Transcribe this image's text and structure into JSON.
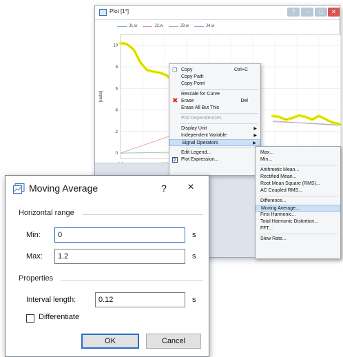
{
  "plot_window": {
    "title": "Plot [1*]",
    "legend": [
      {
        "label": "J1.w",
        "color": "#8da9c9"
      },
      {
        "label": "J2.w",
        "color": "#e88ea0"
      },
      {
        "label": "J3.w",
        "color": "#8fbf8f"
      },
      {
        "label": "J4.w",
        "color": "#c58fd0"
      }
    ],
    "highlight_color": "#f2f200"
  },
  "chart_data": {
    "type": "line",
    "ylabel": "[rad/s]",
    "y_ticks": [
      "10",
      "8",
      "6",
      "4",
      "2",
      "0"
    ],
    "x_ticks": [
      "0.0",
      "0.2"
    ],
    "ylim": [
      -0.5,
      11
    ],
    "xlim": [
      0,
      1.0
    ],
    "grid": true,
    "series": [
      {
        "name": "J1.w",
        "color": "#f2f200",
        "highlighted": true,
        "x": [
          0.0,
          0.03,
          0.06,
          0.09,
          0.12,
          0.15,
          0.18,
          0.21,
          0.24,
          0.27,
          0.3,
          0.33,
          0.36
        ],
        "y": [
          10.2,
          10.1,
          9.6,
          8.4,
          7.7,
          7.55,
          7.45,
          7.2,
          6.6,
          6.4,
          6.1,
          5.95,
          5.7
        ]
      },
      {
        "name": "J1.w (tail)",
        "color": "#f2f200",
        "highlighted": true,
        "x": [
          0.69,
          0.72,
          0.75,
          0.78,
          0.81,
          0.84,
          0.87,
          0.9,
          0.93,
          0.96,
          1.0
        ],
        "y": [
          3.45,
          3.35,
          3.1,
          3.25,
          3.5,
          3.35,
          3.1,
          3.45,
          3.15,
          2.85,
          2.65
        ]
      },
      {
        "name": "J2.w",
        "color": "#e88ea0",
        "x": [
          0.0,
          0.34
        ],
        "y": [
          0.0,
          2.4
        ]
      },
      {
        "name": "J3.w",
        "color": "#8fbf8f",
        "x": [
          0.0,
          0.3
        ],
        "y": [
          0.0,
          0.1
        ]
      },
      {
        "name": "J3.w (tail)",
        "color": "#8fbf8f",
        "x": [
          0.69,
          0.85,
          1.0
        ],
        "y": [
          3.0,
          2.75,
          2.55
        ]
      },
      {
        "name": "J4.w (tail)",
        "color": "#c58fd0",
        "x": [
          0.69,
          0.85,
          1.0
        ],
        "y": [
          2.9,
          2.8,
          2.6
        ]
      }
    ]
  },
  "context_menu": {
    "items": [
      {
        "label": "Copy",
        "shortcut": "Ctrl+C",
        "icon": "copy-icon"
      },
      {
        "label": "Copy Path"
      },
      {
        "label": "Copy Point"
      },
      {
        "sep": true
      },
      {
        "label": "Rescale for Curve"
      },
      {
        "label": "Erase",
        "shortcut": "Del",
        "icon": "erase-icon"
      },
      {
        "label": "Erase All But This"
      },
      {
        "sep": true
      },
      {
        "label": "Plot Dependencies",
        "disabled": true
      },
      {
        "sep": true
      },
      {
        "label": "Display Unit",
        "submenu": true
      },
      {
        "label": "Independent Variable",
        "submenu": true
      },
      {
        "label": "Signal Operators",
        "submenu": true,
        "highlighted": true
      },
      {
        "sep": true
      },
      {
        "label": "Edit Legend..."
      },
      {
        "label": "Plot Expression...",
        "icon": "sigma-icon"
      }
    ]
  },
  "signal_submenu": {
    "items": [
      {
        "label": "Max..."
      },
      {
        "label": "Min..."
      },
      {
        "sep": true
      },
      {
        "label": "Arithmetic Mean..."
      },
      {
        "label": "Rectified Mean..."
      },
      {
        "label": "Root Mean Square (RMS)..."
      },
      {
        "label": "AC Coupled RMS..."
      },
      {
        "sep": true
      },
      {
        "label": "Difference..."
      },
      {
        "label": "Moving Average...",
        "highlighted": true
      },
      {
        "label": "First Harmonic..."
      },
      {
        "label": "Total Harmonic Distortion..."
      },
      {
        "label": "FFT..."
      },
      {
        "sep": true
      },
      {
        "label": "Slew Rate..."
      }
    ]
  },
  "dialog": {
    "title": "Moving Average",
    "help": "?",
    "close": "×",
    "horizontal_range": {
      "label": "Horizontal range",
      "min_label": "Min:",
      "min_value": "0",
      "max_label": "Max:",
      "max_value": "1.2",
      "unit": "s"
    },
    "properties": {
      "label": "Properties",
      "interval_label": "Interval length:",
      "interval_value": "0.12",
      "unit": "s",
      "differentiate_label": "Differentiate",
      "differentiate_checked": false
    },
    "ok_label": "OK",
    "cancel_label": "Cancel"
  }
}
